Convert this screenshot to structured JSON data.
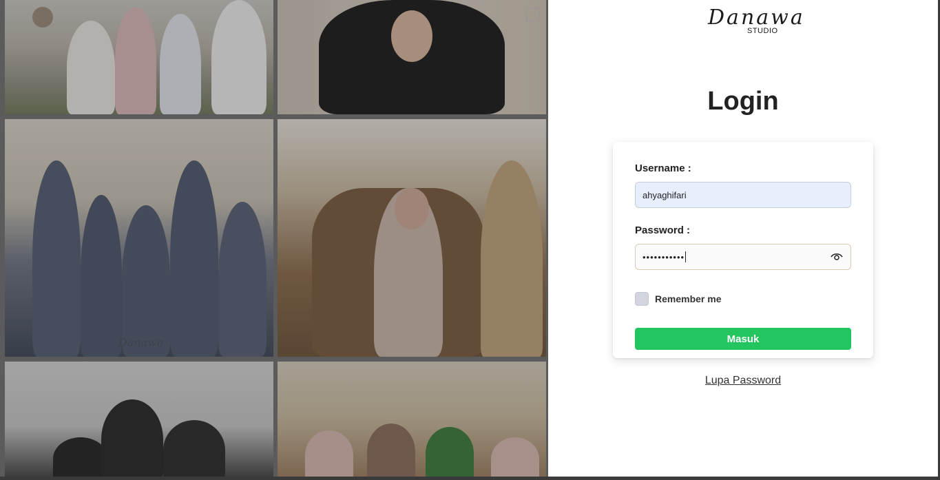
{
  "brand": {
    "script_text": "Danawa",
    "studio_text": "STUDIO"
  },
  "gallery": {
    "watermark": "Danawa"
  },
  "login": {
    "title": "Login",
    "username_label": "Username :",
    "username_value": "ahyaghifari",
    "password_label": "Password :",
    "password_masked": "•••••••••••",
    "remember_label": "Remember me",
    "submit_label": "Masuk",
    "forgot_label": "Lupa Password"
  },
  "colors": {
    "primary_button": "#22c55e",
    "username_fill": "#e8effc"
  },
  "icons": {
    "password_toggle": "eye-icon",
    "gallery_expand": "scan-icon"
  }
}
